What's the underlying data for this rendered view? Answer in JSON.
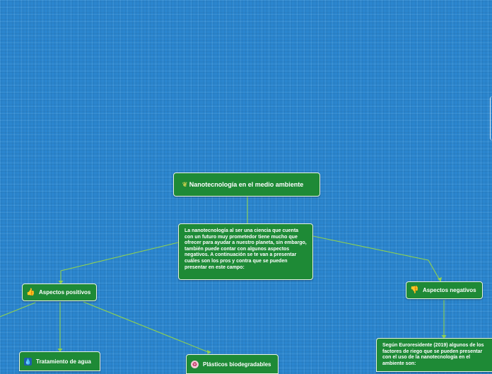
{
  "central_topic": {
    "title": "Nanotecnología en el medio ambiente",
    "icon": "leaf-icon"
  },
  "intro": {
    "text": "La nanotecnología al ser una ciencia que cuenta con un futuro muy prometedor tiene mucho que ofrecer para ayudar a nuestro planeta, sin embargo, también puede contar con algunos aspectos negativos. A continuación se te van a presentar cuáles son los pros y contra que se pueden presentar en este campo:"
  },
  "branches": {
    "positivos": {
      "label": "Aspectos positivos",
      "icon": "thumbs-up-icon"
    },
    "negativos": {
      "label": "Aspectos negativos",
      "icon": "thumbs-down-icon"
    }
  },
  "subtopics": {
    "agua": {
      "label": "Tratamiento de agua",
      "icon": "water-drop-icon"
    },
    "plasticos": {
      "label": "Plásticos biodegradables",
      "icon": "recycle-icon"
    },
    "euro": {
      "text": "Según Euroresidente (2019) algunos de los factores de riego que se pueden presentar con el uso de la nanotecnología en el ambiente son:"
    }
  },
  "colors": {
    "background": "#2b86cf",
    "node_fill": "#1e8a36",
    "node_border": "#e8f3e4",
    "connector": "#8fd14f"
  }
}
